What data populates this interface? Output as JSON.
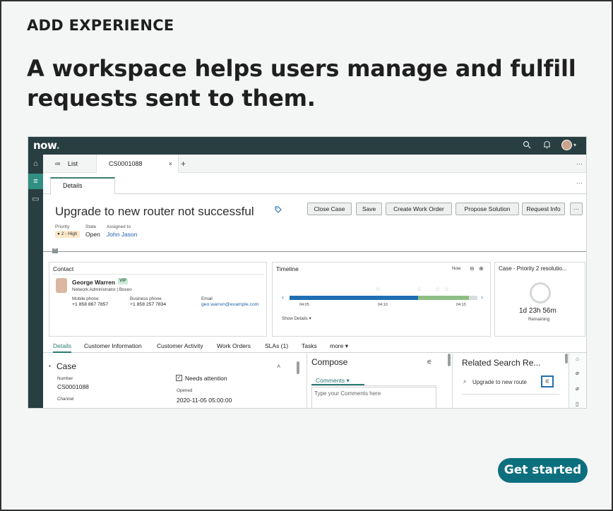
{
  "eyebrow": "ADD EXPERIENCE",
  "headline": "A workspace helps users manage and fulfill requests sent to them.",
  "cta_label": "Get started",
  "colors": {
    "brand_dark": "#293e40",
    "accent": "#0d6f7e",
    "active_nav": "#2f8f82"
  },
  "app": {
    "logo": "now",
    "logo_dot": ".",
    "icons": [
      "search-icon",
      "bell-icon",
      "avatar"
    ]
  },
  "tabs": {
    "list_label": "List",
    "case_label": "CS0001088",
    "close": "×",
    "add": "+",
    "more": "···"
  },
  "subtab": "Details",
  "record": {
    "title": "Upgrade to new router not successful",
    "priority_label": "Priority",
    "priority_value": "● 2 - High",
    "state_label": "State",
    "state_value": "Open",
    "assigned_label": "Assigned to",
    "assigned_value": "John Jason",
    "buttons": [
      "Close Case",
      "Save",
      "Create Work Order",
      "Propose Solution",
      "Request Info",
      "···"
    ]
  },
  "contact": {
    "title": "Contact",
    "name": "George Warren",
    "vip": "VIP",
    "role": "Network Administrator | Boxeo",
    "mobile_label": "Mobile phone",
    "mobile_value": "+1 858 867 7857",
    "business_label": "Business phone",
    "business_value": "+1 858 257 7834",
    "email_label": "Email",
    "email_value": "geo.warren@example.com"
  },
  "timeline": {
    "title": "Timeline",
    "now": "Now",
    "ticks": [
      "04:05",
      "04:10",
      "04:15"
    ],
    "show_details": "Show Details ▾"
  },
  "sla": {
    "title": "Case - Priority 2 resolutio...",
    "time": "1d 23h 56m",
    "remaining": "Remaining"
  },
  "detail_tabs": [
    "Details",
    "Customer Information",
    "Customer Activity",
    "Work Orders",
    "SLAs (1)",
    "Tasks",
    "more ▾"
  ],
  "form": {
    "section": "Case",
    "number_label": "Number",
    "number_value": "CS0001088",
    "channel_label": "Channel",
    "needs_attention": "Needs attention",
    "opened_label": "Opened",
    "opened_value": "2020-11-05 05:00:00"
  },
  "compose": {
    "title": "Compose",
    "tab": "Comments ▾",
    "placeholder": "Type your Comments here"
  },
  "related": {
    "title": "Related Search Re...",
    "search_value": "Upgrade to new route"
  }
}
